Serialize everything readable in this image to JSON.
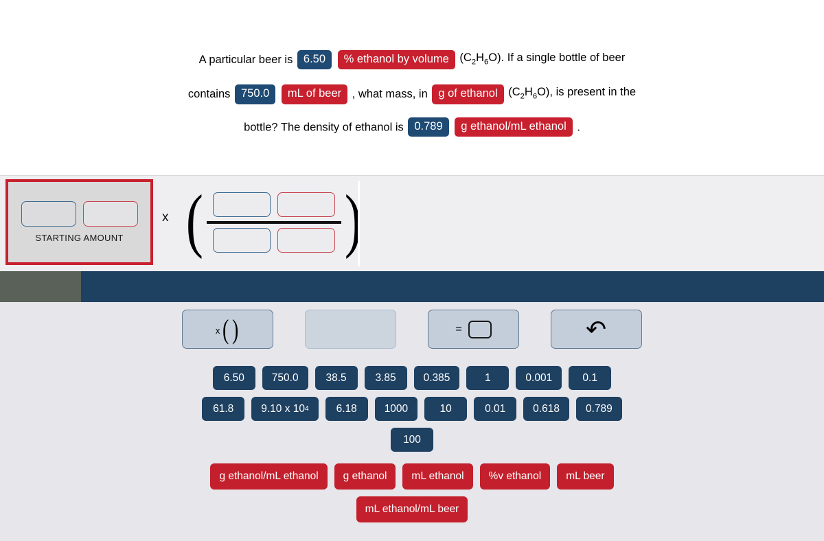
{
  "problem": {
    "line1_pre": "A particular beer is",
    "line1_value": "6.50",
    "line1_unit": "% ethanol by volume",
    "line1_post_formula_open": "(C",
    "line1_post": "O). If a single bottle of beer",
    "line2_pre": "contains",
    "line2_value": "750.0",
    "line2_unit": "mL of beer",
    "line2_mid": ", what mass, in",
    "line2_unit2": "g of ethanol",
    "line2_post": "O), is present in the",
    "line3_pre": "bottle? The density of ethanol is",
    "line3_value": "0.789",
    "line3_unit": "g ethanol/mL ethanol",
    "line3_post": ".",
    "formula": {
      "c": "C",
      "c_sub": "2",
      "h": "H",
      "h_sub": "6",
      "o": "O"
    }
  },
  "work_area": {
    "starting_amount_label": "STARTING AMOUNT",
    "multiply_symbol": "x",
    "paren_open": "(",
    "paren_close": ")"
  },
  "toolbar": {
    "buttons": [
      {
        "name": "multiply-parentheses",
        "x_label": "x",
        "open": "(",
        "close": ")"
      },
      {
        "name": "blank-disabled",
        "label": ""
      },
      {
        "name": "equals-box",
        "equals": "="
      },
      {
        "name": "undo",
        "glyph": "↷"
      }
    ]
  },
  "palette": {
    "numbers_row1": [
      "6.50",
      "750.0",
      "38.5",
      "3.85",
      "0.385",
      "1",
      "0.001",
      "0.1"
    ],
    "numbers_row2": [
      "61.8",
      "9.10 x 10",
      "6.18",
      "1000",
      "10",
      "0.01",
      "0.618",
      "0.789"
    ],
    "sci_exponent": "4",
    "numbers_row3": [
      "100"
    ],
    "units_row1": [
      "g ethanol/mL ethanol",
      "g ethanol",
      "mL ethanol",
      "%v ethanol",
      "mL beer"
    ],
    "units_row2": [
      "mL ethanol/mL beer"
    ]
  },
  "colors": {
    "navy": "#1e4061",
    "red": "#c41f2c",
    "olive_band": "#5a6158",
    "palette_bg": "#e6e6eb",
    "work_bg": "#efeff1"
  }
}
